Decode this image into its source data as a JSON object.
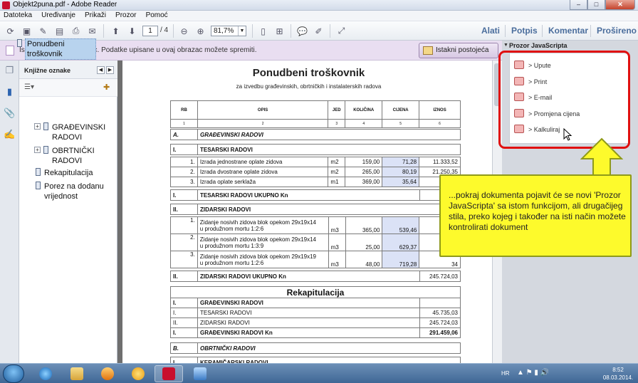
{
  "window": {
    "title": "Objekt2puna.pdf - Adobe Reader",
    "btn_min": "–",
    "btn_max": "□",
    "btn_close": "✕"
  },
  "menu": [
    "Datoteka",
    "Uređivanje",
    "Prikaži",
    "Prozor",
    "Pomoć"
  ],
  "toolbar": {
    "page_current": "1",
    "page_total": "/ 4",
    "zoom": "81,7%",
    "right_tabs": [
      "Alati",
      "Potpis",
      "Komentar",
      "Proširenou"
    ]
  },
  "formbar": {
    "message": "Ispunite sljedeći obrazac. Podatke upisane u ovaj obrazac možete spremiti.",
    "highlight_button": "Istakni postojeća polja"
  },
  "bookmarks": {
    "title": "Knjižne oznake",
    "items": [
      {
        "label": "Ponudbeni troškovnik",
        "expandable": false,
        "selected": true
      },
      {
        "label": "GRAĐEVINSKI RADOVI",
        "expandable": true
      },
      {
        "label": "OBRTNIČKI RADOVI",
        "expandable": true
      },
      {
        "label": "Rekapitulacija",
        "expandable": false
      },
      {
        "label": "Porez na dodanu vrijednost",
        "expandable": false
      }
    ]
  },
  "document": {
    "title": "Ponudbeni troškovnik",
    "subtitle": "za izvedbu građevinskih, obrtničkih i instalaterskih radova",
    "headers": [
      "RB",
      "OPIS",
      "JED",
      "KOLIČINA",
      "CIJENA",
      "IZNOS"
    ],
    "header_nums": [
      "1",
      "2",
      "3",
      "4",
      "5",
      "6"
    ],
    "secA": {
      "rb": "A.",
      "label": "GRAĐEVINSKI RADOVI"
    },
    "sec1": {
      "rb": "I.",
      "label": "TESARSKI RADOVI"
    },
    "rows1": [
      {
        "rb": "1.",
        "opis": "Izrada jednostrane oplate zidova",
        "jed": "m2",
        "kol": "159,00",
        "cij": "71,28",
        "izn": "11.333,52"
      },
      {
        "rb": "2.",
        "opis": "Izrada dvostrane oplate zidova",
        "jed": "m2",
        "kol": "265,00",
        "cij": "80,19",
        "izn": "21.250,35"
      },
      {
        "rb": "3.",
        "opis": "Izrada oplate serklaža",
        "jed": "m1",
        "kol": "369,00",
        "cij": "35,64",
        "izn": "13"
      }
    ],
    "sum1": {
      "rb": "I.",
      "label": "TESARSKI RADOVI UKUPNO Kn",
      "val": "45"
    },
    "sec2": {
      "rb": "II.",
      "label": "ZIDARSKI RADOVI"
    },
    "rows2": [
      {
        "rb": "1.",
        "opis1": "Zidanje nosivih zidova blok opekom 29x19x14",
        "opis2": "u produžnom mortu 1:2:6",
        "jed": "m3",
        "kol": "365,00",
        "cij": "539,46",
        "izn": "196"
      },
      {
        "rb": "2.",
        "opis1": "Zidanje nosivih zidova blok opekom 29x19x14",
        "opis2": "u produžnom mortu 1:3:9",
        "jed": "m3",
        "kol": "25,00",
        "cij": "629,37",
        "izn": "15"
      },
      {
        "rb": "3.",
        "opis1": "Zidanje nosivih zidova blok opekom 29x19x19",
        "opis2": "u produžnom mortu 1:2:6",
        "jed": "m3",
        "kol": "48,00",
        "cij": "719,28",
        "izn": "34"
      }
    ],
    "sum2": {
      "rb": "II.",
      "label": "ZIDARSKI RADOVI UKUPNO Kn",
      "val": "245.724,03"
    },
    "recap_title": "Rekapitulacija",
    "recap": [
      {
        "rb": "I.",
        "label": "GRAĐEVINSKI RADOVI",
        "val": "",
        "bold": true
      },
      {
        "rb": "I.",
        "label": "TESARSKI RADOVI",
        "val": "45.735,03",
        "bold": false
      },
      {
        "rb": "II.",
        "label": "ZIDARSKI RADOVI",
        "val": "245.724,03",
        "bold": false
      },
      {
        "rb": "I.",
        "label": "GRAĐEVINSKI RADOVI Kn",
        "val": "291.459,06",
        "bold": true
      }
    ],
    "secB": {
      "rb": "B.",
      "label": "OBRTNIČKI RADOVI"
    },
    "secB1": {
      "rb": "I.",
      "label": "KERAMIČARSKI RADOVI"
    }
  },
  "js_panel": {
    "title": "Prozor JavaScripta",
    "items": [
      "> Upute",
      "> Print",
      "> E-mail",
      "> Promjena cijena",
      "> Kalkuliraj"
    ]
  },
  "callout": {
    "text": "...pokraj dokumenta pojavit će se novi 'Prozor JavaScripta' sa istom funkcijom, ali drugačijeg stila, preko kojeg i također na isti način možete kontrolirati dokument"
  },
  "tray": {
    "lang": "HR",
    "time": "8:52",
    "date": "08.03.2014."
  },
  "colors": {
    "red_frame": "#e01010",
    "callout_bg": "#fdfa2c",
    "arrow_fill": "#fdfa2c"
  }
}
